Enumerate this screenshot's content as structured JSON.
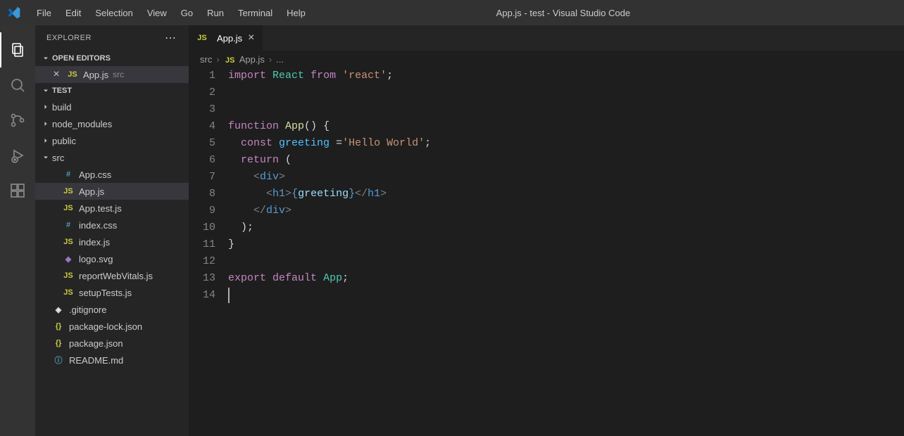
{
  "window": {
    "title": "App.js - test - Visual Studio Code"
  },
  "menu": [
    "File",
    "Edit",
    "Selection",
    "View",
    "Go",
    "Run",
    "Terminal",
    "Help"
  ],
  "activity": {
    "items": [
      {
        "name": "explorer-icon",
        "active": true
      },
      {
        "name": "search-icon",
        "active": false
      },
      {
        "name": "source-control-icon",
        "active": false
      },
      {
        "name": "run-debug-icon",
        "active": false
      },
      {
        "name": "extensions-icon",
        "active": false
      }
    ]
  },
  "sidebar": {
    "title": "EXPLORER",
    "openEditors": {
      "label": "OPEN EDITORS",
      "items": [
        {
          "icon": "js",
          "name": "App.js",
          "desc": "src"
        }
      ]
    },
    "project": {
      "label": "TEST",
      "tree": [
        {
          "type": "folder",
          "name": "build",
          "expanded": false,
          "depth": 1
        },
        {
          "type": "folder",
          "name": "node_modules",
          "expanded": false,
          "depth": 1
        },
        {
          "type": "folder",
          "name": "public",
          "expanded": false,
          "depth": 1
        },
        {
          "type": "folder",
          "name": "src",
          "expanded": true,
          "depth": 1
        },
        {
          "type": "file",
          "icon": "css",
          "iconText": "#",
          "name": "App.css",
          "depth": 2,
          "active": false
        },
        {
          "type": "file",
          "icon": "js",
          "iconText": "JS",
          "name": "App.js",
          "depth": 2,
          "active": true
        },
        {
          "type": "file",
          "icon": "js",
          "iconText": "JS",
          "name": "App.test.js",
          "depth": 2,
          "active": false
        },
        {
          "type": "file",
          "icon": "css",
          "iconText": "#",
          "name": "index.css",
          "depth": 2,
          "active": false
        },
        {
          "type": "file",
          "icon": "js",
          "iconText": "JS",
          "name": "index.js",
          "depth": 2,
          "active": false
        },
        {
          "type": "file",
          "icon": "svg",
          "iconText": "◆",
          "name": "logo.svg",
          "depth": 2,
          "active": false
        },
        {
          "type": "file",
          "icon": "js",
          "iconText": "JS",
          "name": "reportWebVitals.js",
          "depth": 2,
          "active": false
        },
        {
          "type": "file",
          "icon": "js",
          "iconText": "JS",
          "name": "setupTests.js",
          "depth": 2,
          "active": false
        },
        {
          "type": "file",
          "icon": "git",
          "iconText": "◈",
          "name": ".gitignore",
          "depth": 1,
          "active": false
        },
        {
          "type": "file",
          "icon": "json",
          "iconText": "{}",
          "name": "package-lock.json",
          "depth": 1,
          "active": false
        },
        {
          "type": "file",
          "icon": "json",
          "iconText": "{}",
          "name": "package.json",
          "depth": 1,
          "active": false
        },
        {
          "type": "file",
          "icon": "md",
          "iconText": "ⓘ",
          "name": "README.md",
          "depth": 1,
          "active": false
        }
      ]
    }
  },
  "tabs": [
    {
      "icon": "js",
      "label": "App.js",
      "active": true
    }
  ],
  "breadcrumbs": [
    "src",
    "App.js",
    "..."
  ],
  "code": {
    "lines": [
      [
        {
          "cls": "tk-kw",
          "t": "import"
        },
        {
          "cls": "tk-default",
          "t": " "
        },
        {
          "cls": "tk-type",
          "t": "React"
        },
        {
          "cls": "tk-default",
          "t": " "
        },
        {
          "cls": "tk-kw",
          "t": "from"
        },
        {
          "cls": "tk-default",
          "t": " "
        },
        {
          "cls": "tk-str",
          "t": "'react'"
        },
        {
          "cls": "tk-pn",
          "t": ";"
        }
      ],
      [],
      [],
      [
        {
          "cls": "tk-kw",
          "t": "function"
        },
        {
          "cls": "tk-default",
          "t": " "
        },
        {
          "cls": "tk-fn",
          "t": "App"
        },
        {
          "cls": "tk-pn",
          "t": "() "
        },
        {
          "cls": "tk-pn",
          "t": "{"
        }
      ],
      [
        {
          "cls": "tk-default",
          "t": "  "
        },
        {
          "cls": "tk-kw",
          "t": "const"
        },
        {
          "cls": "tk-default",
          "t": " "
        },
        {
          "cls": "tk-const",
          "t": "greeting"
        },
        {
          "cls": "tk-default",
          "t": " ="
        },
        {
          "cls": "tk-str",
          "t": "'Hello World'"
        },
        {
          "cls": "tk-pn",
          "t": ";"
        }
      ],
      [
        {
          "cls": "tk-default",
          "t": "  "
        },
        {
          "cls": "tk-kw",
          "t": "return"
        },
        {
          "cls": "tk-default",
          "t": " ("
        }
      ],
      [
        {
          "cls": "tk-default",
          "t": "    "
        },
        {
          "cls": "tk-tag",
          "t": "<"
        },
        {
          "cls": "tk-tagname",
          "t": "div"
        },
        {
          "cls": "tk-tag",
          "t": ">"
        }
      ],
      [
        {
          "cls": "tk-default",
          "t": "      "
        },
        {
          "cls": "tk-tag",
          "t": "<"
        },
        {
          "cls": "tk-tagname",
          "t": "h1"
        },
        {
          "cls": "tk-tag",
          "t": ">"
        },
        {
          "cls": "tk-brace",
          "t": "{"
        },
        {
          "cls": "tk-var",
          "t": "greeting"
        },
        {
          "cls": "tk-brace",
          "t": "}"
        },
        {
          "cls": "tk-tag",
          "t": "</"
        },
        {
          "cls": "tk-tagname",
          "t": "h1"
        },
        {
          "cls": "tk-tag",
          "t": ">"
        }
      ],
      [
        {
          "cls": "tk-default",
          "t": "    "
        },
        {
          "cls": "tk-tag",
          "t": "</"
        },
        {
          "cls": "tk-tagname",
          "t": "div"
        },
        {
          "cls": "tk-tag",
          "t": ">"
        }
      ],
      [
        {
          "cls": "tk-default",
          "t": "  );"
        }
      ],
      [
        {
          "cls": "tk-pn",
          "t": "}"
        }
      ],
      [],
      [
        {
          "cls": "tk-kw",
          "t": "export"
        },
        {
          "cls": "tk-default",
          "t": " "
        },
        {
          "cls": "tk-kw",
          "t": "default"
        },
        {
          "cls": "tk-default",
          "t": " "
        },
        {
          "cls": "tk-type",
          "t": "App"
        },
        {
          "cls": "tk-pn",
          "t": ";"
        }
      ],
      [
        {
          "cls": "cursor",
          "t": ""
        }
      ]
    ]
  }
}
